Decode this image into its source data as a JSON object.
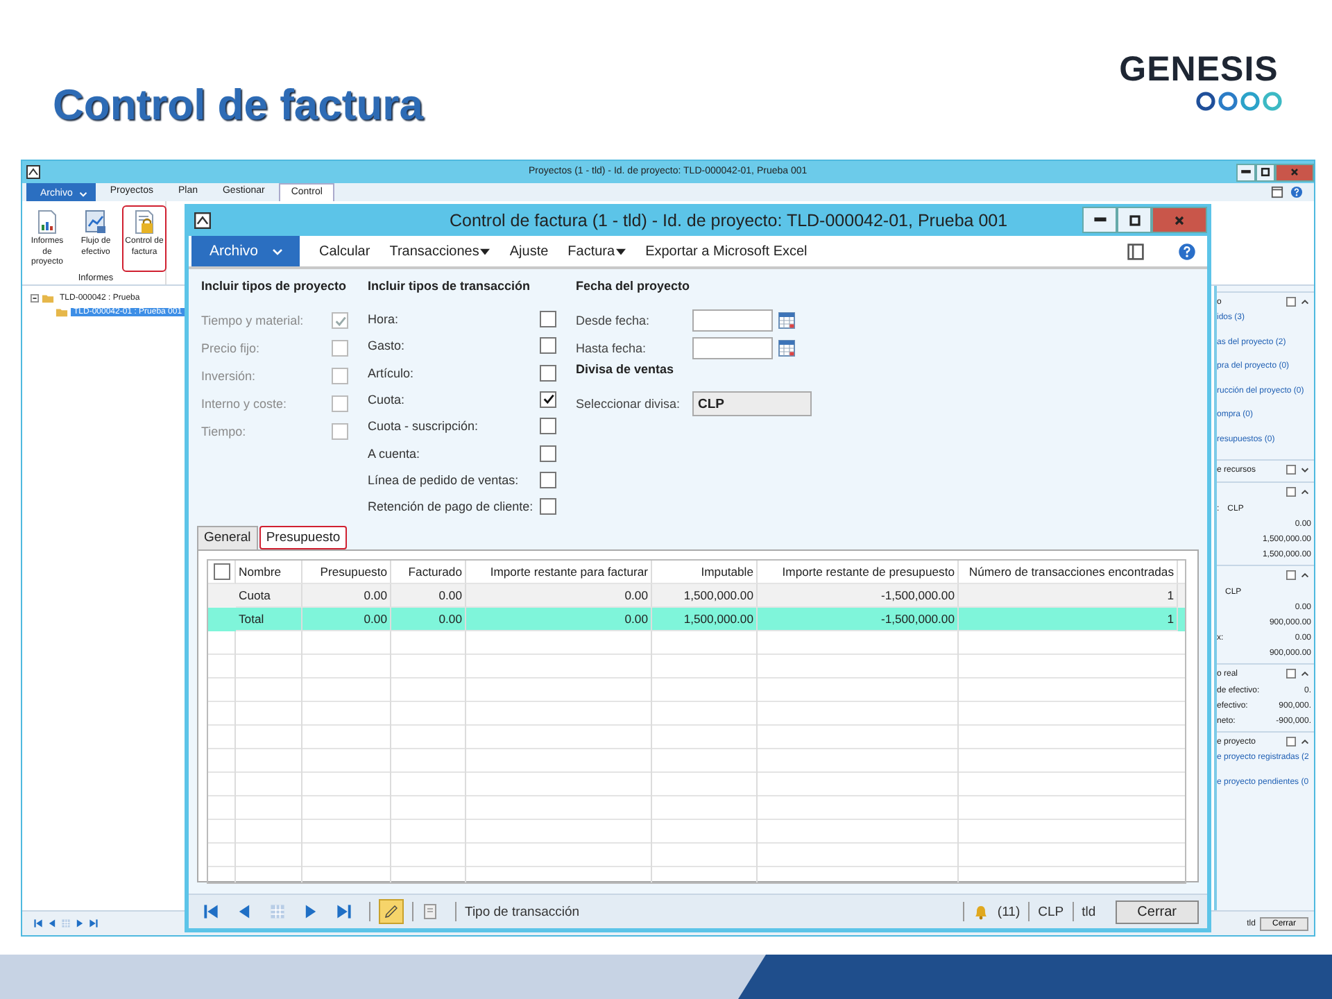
{
  "slide": {
    "title": "Control de factura",
    "logo": "GENESIS"
  },
  "main_window": {
    "title": "Proyectos (1 - tld) - Id. de proyecto: TLD-000042-01, Prueba 001",
    "file_menu": "Archivo",
    "ribbon_tabs": [
      {
        "label": "Proyectos",
        "selected": false
      },
      {
        "label": "Plan",
        "selected": false
      },
      {
        "label": "Gestionar",
        "selected": false
      },
      {
        "label": "Control",
        "selected": true
      }
    ],
    "ribbon_buttons": [
      {
        "label": "Informes de proyecto",
        "kind": "report",
        "highlighted": false
      },
      {
        "label": "Flujo de efectivo",
        "kind": "flow",
        "highlighted": false
      },
      {
        "label": "Control de factura",
        "kind": "lock",
        "highlighted": true
      }
    ],
    "ribbon_group": "Informes",
    "tree": [
      {
        "label": "TLD-000042 : Prueba",
        "selected": false,
        "children": [
          {
            "label": "TLD-000042-01 : Prueba 001",
            "selected": true
          }
        ]
      }
    ],
    "factbox": [
      {
        "heading": "o",
        "expanded": true,
        "lines": [
          {
            "kind": "link",
            "text": "idos (3)"
          },
          {
            "kind": "link",
            "text": "as del proyecto (2)"
          },
          {
            "kind": "link",
            "text": "pra del proyecto (0)"
          },
          {
            "kind": "link",
            "text": "rucción del proyecto (0)"
          },
          {
            "kind": "link",
            "text": "ompra (0)"
          },
          {
            "kind": "link",
            "text": "resupuestos (0)"
          }
        ]
      },
      {
        "heading": "e recursos",
        "expanded": false
      },
      {
        "expanded": true,
        "lines": [
          {
            "kind": "currency",
            "label": ":",
            "text": "CLP"
          },
          {
            "kind": "amount",
            "text": "0.00"
          },
          {
            "kind": "amount",
            "text": "1,500,000.00"
          },
          {
            "kind": "amount",
            "text": "1,500,000.00"
          }
        ]
      },
      {
        "expanded": true,
        "lines": [
          {
            "kind": "currency",
            "text": "CLP"
          },
          {
            "kind": "amount",
            "text": "0.00"
          },
          {
            "kind": "amount",
            "text": "900,000.00"
          },
          {
            "kind": "amount",
            "label": "x:",
            "text": "0.00"
          },
          {
            "kind": "amount",
            "text": "900,000.00"
          }
        ]
      },
      {
        "heading": "o real",
        "expanded": true,
        "lines": [
          {
            "kind": "amount",
            "label": "de efectivo:",
            "text": "0."
          },
          {
            "kind": "amount",
            "label": "efectivo:",
            "text": "900,000."
          },
          {
            "kind": "amount",
            "label": "neto:",
            "text": "-900,000."
          }
        ]
      },
      {
        "heading": "e proyecto",
        "expanded": true,
        "lines": [
          {
            "kind": "link",
            "text": "e proyecto registradas (2"
          },
          {
            "kind": "link",
            "text": "e proyecto pendientes (0"
          }
        ]
      }
    ],
    "status_bar": {
      "company": "tld",
      "close": "Cerrar"
    }
  },
  "dialog": {
    "title": "Control de factura (1 - tld) - Id. de proyecto: TLD-000042-01, Prueba 001",
    "file_menu": "Archivo",
    "menu": [
      {
        "label": "Calcular",
        "dropdown": false
      },
      {
        "label": "Transacciones",
        "dropdown": true
      },
      {
        "label": "Ajuste",
        "dropdown": false
      },
      {
        "label": "Factura",
        "dropdown": true
      },
      {
        "label": "Exportar a Microsoft Excel",
        "dropdown": false
      }
    ],
    "project_types": {
      "title": "Incluir tipos de proyecto",
      "items": [
        {
          "label": "Tiempo y material:",
          "checked": true,
          "disabled": true
        },
        {
          "label": "Precio fijo:",
          "checked": false,
          "disabled": true
        },
        {
          "label": "Inversión:",
          "checked": false,
          "disabled": true
        },
        {
          "label": "Interno y coste:",
          "checked": false,
          "disabled": true
        },
        {
          "label": "Tiempo:",
          "checked": false,
          "disabled": true
        }
      ]
    },
    "transaction_types": {
      "title": "Incluir tipos de transacción",
      "items": [
        {
          "label": "Hora:",
          "checked": false,
          "disabled": false
        },
        {
          "label": "Gasto:",
          "checked": false,
          "disabled": false
        },
        {
          "label": "Artículo:",
          "checked": false,
          "disabled": false
        },
        {
          "label": "Cuota:",
          "checked": true,
          "disabled": false
        },
        {
          "label": "Cuota - suscripción:",
          "checked": false,
          "disabled": false
        },
        {
          "label": "A cuenta:",
          "checked": false,
          "disabled": false
        },
        {
          "label": "Línea de pedido de ventas:",
          "checked": false,
          "disabled": false
        },
        {
          "label": "Retención de pago de cliente:",
          "checked": false,
          "disabled": false
        }
      ]
    },
    "project_dates": {
      "title": "Fecha del proyecto",
      "fields": [
        {
          "label": "Desde fecha:"
        },
        {
          "label": "Hasta fecha:"
        }
      ]
    },
    "sales_currency": {
      "title": "Divisa de ventas",
      "label": "Seleccionar divisa:",
      "value": "CLP"
    },
    "tabs": [
      {
        "label": "General",
        "selected": false,
        "highlighted": false
      },
      {
        "label": "Presupuesto",
        "selected": true,
        "highlighted": true
      }
    ],
    "table": {
      "header_checkbox": {
        "checked": false
      },
      "columns": [
        "Nombre",
        "Presupuesto",
        "Facturado",
        "Importe restante para facturar",
        "Imputable",
        "Importe restante de presupuesto",
        "Número de transacciones encontradas"
      ],
      "rows": [
        {
          "selected": false,
          "cells": [
            "Cuota",
            "0.00",
            "0.00",
            "0.00",
            "1,500,000.00",
            "-1,500,000.00",
            "1"
          ]
        },
        {
          "selected": true,
          "cells": [
            "Total",
            "0.00",
            "0.00",
            "0.00",
            "1,500,000.00",
            "-1,500,000.00",
            "1"
          ]
        }
      ]
    },
    "status_bar": {
      "text": "Tipo de transacción",
      "notifications": "(11)",
      "currency": "CLP",
      "company": "tld",
      "close": "Cerrar"
    }
  }
}
